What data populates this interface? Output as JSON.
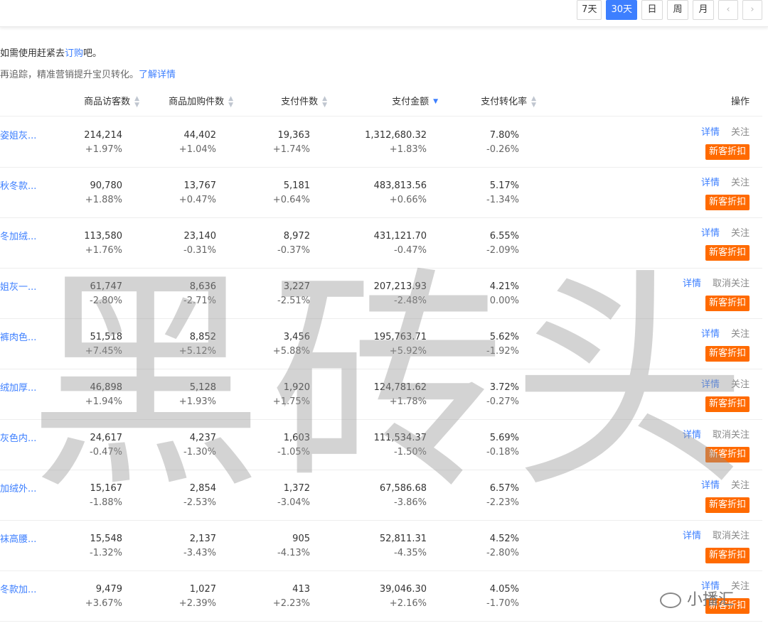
{
  "toolbar": {
    "buttons": [
      "7天",
      "30天",
      "日",
      "周",
      "月"
    ],
    "active": "30天",
    "prev_icon": "chevron-left-icon",
    "next_icon": "chevron-right-icon"
  },
  "notices": {
    "line1_text": "如需使用赶紧去",
    "line1_link": "订购",
    "line1_suffix": "吧。",
    "line2_text": "再追踪，精准营销提升宝贝转化。",
    "line2_link": "了解详情"
  },
  "table": {
    "headers": {
      "visitors": "商品访客数",
      "cart": "商品加购件数",
      "pay_items": "支付件数",
      "pay_amount": "支付金额",
      "conversion": "支付转化率",
      "actions": "操作"
    },
    "sorted_column": "pay_amount",
    "rows": [
      {
        "name": "姿姐灰...",
        "visitors": "214,214",
        "visitors_chg": "+1.97%",
        "cart": "44,402",
        "cart_chg": "+1.04%",
        "pay_items": "19,363",
        "pay_items_chg": "+1.74%",
        "pay_amount": "1,312,680.32",
        "pay_amount_chg": "+1.83%",
        "conversion": "7.80%",
        "conversion_chg": "-0.26%",
        "detail": "详情",
        "follow": "关注",
        "promo": "新客折扣"
      },
      {
        "name": "秋冬款...",
        "visitors": "90,780",
        "visitors_chg": "+1.88%",
        "cart": "13,767",
        "cart_chg": "+0.47%",
        "pay_items": "5,181",
        "pay_items_chg": "+0.64%",
        "pay_amount": "483,813.56",
        "pay_amount_chg": "+0.66%",
        "conversion": "5.17%",
        "conversion_chg": "-1.34%",
        "detail": "详情",
        "follow": "关注",
        "promo": "新客折扣"
      },
      {
        "name": "冬加绒...",
        "visitors": "113,580",
        "visitors_chg": "+1.76%",
        "cart": "23,140",
        "cart_chg": "-0.31%",
        "pay_items": "8,972",
        "pay_items_chg": "-0.37%",
        "pay_amount": "431,121.70",
        "pay_amount_chg": "-0.47%",
        "conversion": "6.55%",
        "conversion_chg": "-2.09%",
        "detail": "详情",
        "follow": "关注",
        "promo": "新客折扣"
      },
      {
        "name": "姐灰一...",
        "visitors": "61,747",
        "visitors_chg": "-2.80%",
        "cart": "8,636",
        "cart_chg": "-2.71%",
        "pay_items": "3,227",
        "pay_items_chg": "-2.51%",
        "pay_amount": "207,213.93",
        "pay_amount_chg": "-2.48%",
        "conversion": "4.21%",
        "conversion_chg": "0.00%",
        "detail": "详情",
        "follow": "取消关注",
        "promo": "新客折扣"
      },
      {
        "name": "裤肉色...",
        "visitors": "51,518",
        "visitors_chg": "+7.45%",
        "cart": "8,852",
        "cart_chg": "+5.12%",
        "pay_items": "3,456",
        "pay_items_chg": "+5.88%",
        "pay_amount": "195,763.71",
        "pay_amount_chg": "+5.92%",
        "conversion": "5.62%",
        "conversion_chg": "-1.92%",
        "detail": "详情",
        "follow": "关注",
        "promo": "新客折扣"
      },
      {
        "name": "绒加厚...",
        "visitors": "46,898",
        "visitors_chg": "+1.94%",
        "cart": "5,128",
        "cart_chg": "+1.93%",
        "pay_items": "1,920",
        "pay_items_chg": "+1.75%",
        "pay_amount": "124,781.62",
        "pay_amount_chg": "+1.78%",
        "conversion": "3.72%",
        "conversion_chg": "-0.27%",
        "detail": "详情",
        "follow": "关注",
        "promo": "新客折扣"
      },
      {
        "name": "灰色内...",
        "visitors": "24,617",
        "visitors_chg": "-0.47%",
        "cart": "4,237",
        "cart_chg": "-1.30%",
        "pay_items": "1,603",
        "pay_items_chg": "-1.05%",
        "pay_amount": "111,534.37",
        "pay_amount_chg": "-1.50%",
        "conversion": "5.69%",
        "conversion_chg": "-0.18%",
        "detail": "详情",
        "follow": "取消关注",
        "promo": "新客折扣"
      },
      {
        "name": "加绒外...",
        "visitors": "15,167",
        "visitors_chg": "-1.88%",
        "cart": "2,854",
        "cart_chg": "-2.53%",
        "pay_items": "1,372",
        "pay_items_chg": "-3.04%",
        "pay_amount": "67,586.68",
        "pay_amount_chg": "-3.86%",
        "conversion": "6.57%",
        "conversion_chg": "-2.23%",
        "detail": "详情",
        "follow": "关注",
        "promo": "新客折扣"
      },
      {
        "name": "袜高腰...",
        "visitors": "15,548",
        "visitors_chg": "-1.32%",
        "cart": "2,137",
        "cart_chg": "-3.43%",
        "pay_items": "905",
        "pay_items_chg": "-4.13%",
        "pay_amount": "52,811.31",
        "pay_amount_chg": "-4.35%",
        "conversion": "4.52%",
        "conversion_chg": "-2.80%",
        "detail": "详情",
        "follow": "取消关注",
        "promo": "新客折扣"
      },
      {
        "name": "冬款加...",
        "visitors": "9,479",
        "visitors_chg": "+3.67%",
        "cart": "1,027",
        "cart_chg": "+2.39%",
        "pay_items": "413",
        "pay_items_chg": "+2.23%",
        "pay_amount": "39,046.30",
        "pay_amount_chg": "+2.16%",
        "conversion": "4.05%",
        "conversion_chg": "-1.70%",
        "detail": "详情",
        "follow": "关注",
        "promo": "新客折扣"
      }
    ]
  },
  "watermark": "黑砖头",
  "wechat_tag": "小播汇",
  "colors": {
    "accent": "#3d7fff",
    "promo": "#ff6a00"
  }
}
